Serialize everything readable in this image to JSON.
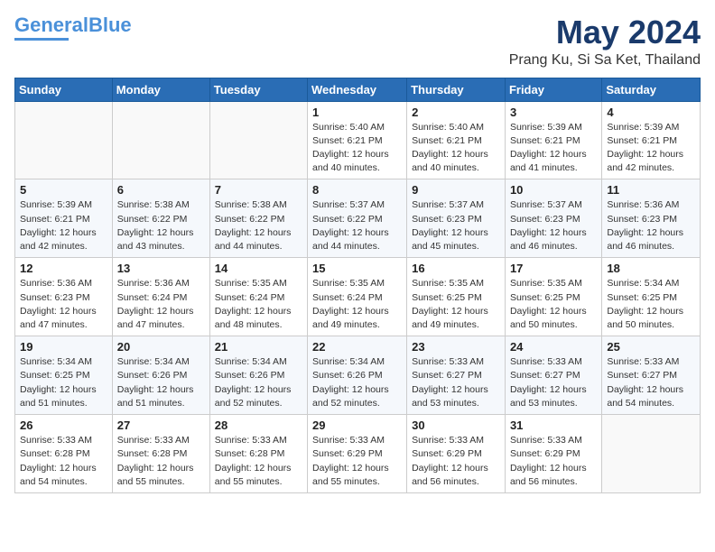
{
  "header": {
    "logo_line1": "General",
    "logo_line2": "Blue",
    "month": "May 2024",
    "location": "Prang Ku, Si Sa Ket, Thailand"
  },
  "weekdays": [
    "Sunday",
    "Monday",
    "Tuesday",
    "Wednesday",
    "Thursday",
    "Friday",
    "Saturday"
  ],
  "weeks": [
    [
      {
        "day": "",
        "sunrise": "",
        "sunset": "",
        "daylight": ""
      },
      {
        "day": "",
        "sunrise": "",
        "sunset": "",
        "daylight": ""
      },
      {
        "day": "",
        "sunrise": "",
        "sunset": "",
        "daylight": ""
      },
      {
        "day": "1",
        "sunrise": "Sunrise: 5:40 AM",
        "sunset": "Sunset: 6:21 PM",
        "daylight": "Daylight: 12 hours and 40 minutes."
      },
      {
        "day": "2",
        "sunrise": "Sunrise: 5:40 AM",
        "sunset": "Sunset: 6:21 PM",
        "daylight": "Daylight: 12 hours and 40 minutes."
      },
      {
        "day": "3",
        "sunrise": "Sunrise: 5:39 AM",
        "sunset": "Sunset: 6:21 PM",
        "daylight": "Daylight: 12 hours and 41 minutes."
      },
      {
        "day": "4",
        "sunrise": "Sunrise: 5:39 AM",
        "sunset": "Sunset: 6:21 PM",
        "daylight": "Daylight: 12 hours and 42 minutes."
      }
    ],
    [
      {
        "day": "5",
        "sunrise": "Sunrise: 5:39 AM",
        "sunset": "Sunset: 6:21 PM",
        "daylight": "Daylight: 12 hours and 42 minutes."
      },
      {
        "day": "6",
        "sunrise": "Sunrise: 5:38 AM",
        "sunset": "Sunset: 6:22 PM",
        "daylight": "Daylight: 12 hours and 43 minutes."
      },
      {
        "day": "7",
        "sunrise": "Sunrise: 5:38 AM",
        "sunset": "Sunset: 6:22 PM",
        "daylight": "Daylight: 12 hours and 44 minutes."
      },
      {
        "day": "8",
        "sunrise": "Sunrise: 5:37 AM",
        "sunset": "Sunset: 6:22 PM",
        "daylight": "Daylight: 12 hours and 44 minutes."
      },
      {
        "day": "9",
        "sunrise": "Sunrise: 5:37 AM",
        "sunset": "Sunset: 6:23 PM",
        "daylight": "Daylight: 12 hours and 45 minutes."
      },
      {
        "day": "10",
        "sunrise": "Sunrise: 5:37 AM",
        "sunset": "Sunset: 6:23 PM",
        "daylight": "Daylight: 12 hours and 46 minutes."
      },
      {
        "day": "11",
        "sunrise": "Sunrise: 5:36 AM",
        "sunset": "Sunset: 6:23 PM",
        "daylight": "Daylight: 12 hours and 46 minutes."
      }
    ],
    [
      {
        "day": "12",
        "sunrise": "Sunrise: 5:36 AM",
        "sunset": "Sunset: 6:23 PM",
        "daylight": "Daylight: 12 hours and 47 minutes."
      },
      {
        "day": "13",
        "sunrise": "Sunrise: 5:36 AM",
        "sunset": "Sunset: 6:24 PM",
        "daylight": "Daylight: 12 hours and 47 minutes."
      },
      {
        "day": "14",
        "sunrise": "Sunrise: 5:35 AM",
        "sunset": "Sunset: 6:24 PM",
        "daylight": "Daylight: 12 hours and 48 minutes."
      },
      {
        "day": "15",
        "sunrise": "Sunrise: 5:35 AM",
        "sunset": "Sunset: 6:24 PM",
        "daylight": "Daylight: 12 hours and 49 minutes."
      },
      {
        "day": "16",
        "sunrise": "Sunrise: 5:35 AM",
        "sunset": "Sunset: 6:25 PM",
        "daylight": "Daylight: 12 hours and 49 minutes."
      },
      {
        "day": "17",
        "sunrise": "Sunrise: 5:35 AM",
        "sunset": "Sunset: 6:25 PM",
        "daylight": "Daylight: 12 hours and 50 minutes."
      },
      {
        "day": "18",
        "sunrise": "Sunrise: 5:34 AM",
        "sunset": "Sunset: 6:25 PM",
        "daylight": "Daylight: 12 hours and 50 minutes."
      }
    ],
    [
      {
        "day": "19",
        "sunrise": "Sunrise: 5:34 AM",
        "sunset": "Sunset: 6:25 PM",
        "daylight": "Daylight: 12 hours and 51 minutes."
      },
      {
        "day": "20",
        "sunrise": "Sunrise: 5:34 AM",
        "sunset": "Sunset: 6:26 PM",
        "daylight": "Daylight: 12 hours and 51 minutes."
      },
      {
        "day": "21",
        "sunrise": "Sunrise: 5:34 AM",
        "sunset": "Sunset: 6:26 PM",
        "daylight": "Daylight: 12 hours and 52 minutes."
      },
      {
        "day": "22",
        "sunrise": "Sunrise: 5:34 AM",
        "sunset": "Sunset: 6:26 PM",
        "daylight": "Daylight: 12 hours and 52 minutes."
      },
      {
        "day": "23",
        "sunrise": "Sunrise: 5:33 AM",
        "sunset": "Sunset: 6:27 PM",
        "daylight": "Daylight: 12 hours and 53 minutes."
      },
      {
        "day": "24",
        "sunrise": "Sunrise: 5:33 AM",
        "sunset": "Sunset: 6:27 PM",
        "daylight": "Daylight: 12 hours and 53 minutes."
      },
      {
        "day": "25",
        "sunrise": "Sunrise: 5:33 AM",
        "sunset": "Sunset: 6:27 PM",
        "daylight": "Daylight: 12 hours and 54 minutes."
      }
    ],
    [
      {
        "day": "26",
        "sunrise": "Sunrise: 5:33 AM",
        "sunset": "Sunset: 6:28 PM",
        "daylight": "Daylight: 12 hours and 54 minutes."
      },
      {
        "day": "27",
        "sunrise": "Sunrise: 5:33 AM",
        "sunset": "Sunset: 6:28 PM",
        "daylight": "Daylight: 12 hours and 55 minutes."
      },
      {
        "day": "28",
        "sunrise": "Sunrise: 5:33 AM",
        "sunset": "Sunset: 6:28 PM",
        "daylight": "Daylight: 12 hours and 55 minutes."
      },
      {
        "day": "29",
        "sunrise": "Sunrise: 5:33 AM",
        "sunset": "Sunset: 6:29 PM",
        "daylight": "Daylight: 12 hours and 55 minutes."
      },
      {
        "day": "30",
        "sunrise": "Sunrise: 5:33 AM",
        "sunset": "Sunset: 6:29 PM",
        "daylight": "Daylight: 12 hours and 56 minutes."
      },
      {
        "day": "31",
        "sunrise": "Sunrise: 5:33 AM",
        "sunset": "Sunset: 6:29 PM",
        "daylight": "Daylight: 12 hours and 56 minutes."
      },
      {
        "day": "",
        "sunrise": "",
        "sunset": "",
        "daylight": ""
      }
    ]
  ]
}
